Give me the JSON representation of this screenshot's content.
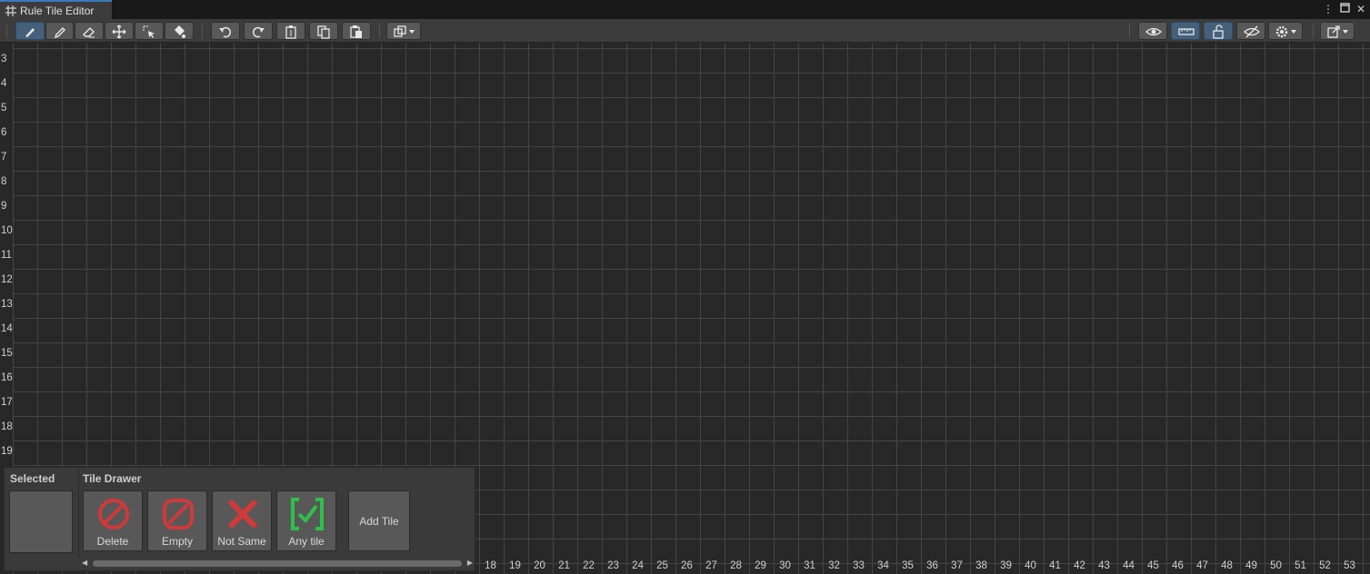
{
  "window": {
    "tab_title": "Rule Tile Editor",
    "controls": [
      "more-menu",
      "maximize",
      "close"
    ]
  },
  "toolbar": {
    "left_tools": [
      {
        "name": "brush-icon",
        "active": true
      },
      {
        "name": "picker-icon",
        "active": false
      },
      {
        "name": "eraser-icon",
        "active": false
      },
      {
        "name": "move-icon",
        "active": false
      },
      {
        "name": "select-icon",
        "active": false
      },
      {
        "name": "fill-icon",
        "active": false
      }
    ],
    "history_tools": [
      "undo-icon",
      "redo-icon",
      "clipboard-icon",
      "copy-icon",
      "paste-icon"
    ],
    "layout_dropdown": "layout-icon",
    "right_tools": [
      "visibility-icon",
      "ruler-icon",
      "lock-icon",
      "hide-icon",
      "settings-icon",
      "export-icon"
    ]
  },
  "grid": {
    "row_labels": [
      "3",
      "4",
      "5",
      "6",
      "7",
      "8",
      "9",
      "10",
      "11",
      "12",
      "13",
      "14",
      "15",
      "16",
      "17",
      "18",
      "19"
    ],
    "col_labels": [
      "18",
      "19",
      "20",
      "21",
      "22",
      "23",
      "24",
      "25",
      "26",
      "27",
      "28",
      "29",
      "30",
      "31",
      "32",
      "33",
      "34",
      "35",
      "36",
      "37",
      "38",
      "39",
      "40",
      "41",
      "42",
      "43",
      "44",
      "45",
      "46",
      "47",
      "48",
      "49",
      "50",
      "51",
      "52",
      "53"
    ]
  },
  "panel": {
    "selected_title": "Selected",
    "drawer_title": "Tile Drawer",
    "buttons": [
      {
        "label": "Delete",
        "icon": "delete-icon",
        "color": "#d0393a"
      },
      {
        "label": "Empty",
        "icon": "empty-icon",
        "color": "#d0393a"
      },
      {
        "label": "Not Same",
        "icon": "not-same-icon",
        "color": "#d0393a"
      },
      {
        "label": "Any tile",
        "icon": "any-tile-icon",
        "color": "#2fbf4a"
      }
    ],
    "add_tile": "Add Tile"
  }
}
